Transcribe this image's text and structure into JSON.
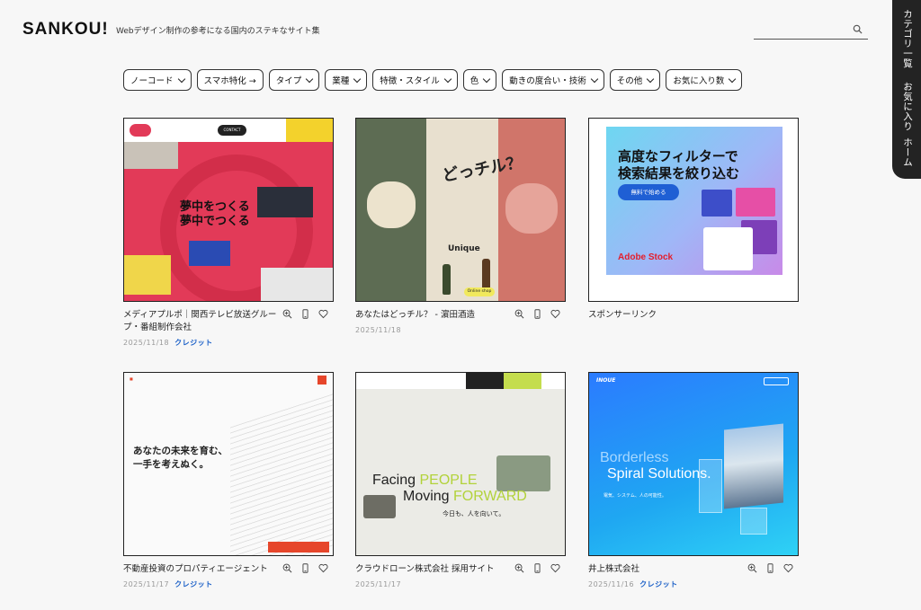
{
  "header": {
    "logo": "SANKOU!",
    "tagline": "Webデザイン制作の参考になる国内のステキなサイト集",
    "search_placeholder": ""
  },
  "side_tab": {
    "items": [
      "カテゴリ一覧",
      "お気に入り",
      "ホーム"
    ]
  },
  "filters": [
    {
      "label": "ノーコード",
      "icon": "chevron-down"
    },
    {
      "label": "スマホ特化 →",
      "icon": "none"
    },
    {
      "label": "タイプ",
      "icon": "chevron-down"
    },
    {
      "label": "業種",
      "icon": "chevron-down"
    },
    {
      "label": "特徴・スタイル",
      "icon": "chevron-down"
    },
    {
      "label": "色",
      "icon": "chevron-down"
    },
    {
      "label": "動きの度合い・技術",
      "icon": "chevron-down"
    },
    {
      "label": "その他",
      "icon": "chevron-down"
    },
    {
      "label": "お気に入り数",
      "icon": "chevron-down"
    }
  ],
  "cards": [
    {
      "title": "メディアプルポ｜関西テレビ放送グループ・番組制作会社",
      "date": "2025/11/18",
      "credit": "クレジット",
      "thumb": {
        "jp_line1": "夢中をつくる",
        "jp_line2": "夢中でつくる",
        "contact": "CONTACT"
      }
    },
    {
      "title": "あなたはどっチル？ - 濵田酒造",
      "date": "2025/11/18",
      "credit": "",
      "thumb": {
        "big": "どっチル？",
        "unique": "Unique",
        "shop": "Online shop"
      }
    },
    {
      "title": "スポンサーリンク",
      "date": "",
      "credit": "",
      "thumb": {
        "headline_1": "高度なフィルターで",
        "headline_2": "検索結果を絞り込む",
        "button": "無料で始める",
        "brand": "Adobe Stock"
      }
    },
    {
      "title": "不動産投資のプロパティエージェント",
      "date": "2025/11/17",
      "credit": "クレジット",
      "thumb": {
        "line1": "あなたの未来を育む、",
        "line2": "一手を考えぬく。"
      }
    },
    {
      "title": "クラウドローン株式会社 採用サイト",
      "date": "2025/11/17",
      "credit": "",
      "thumb": {
        "facing": "Facing ",
        "people": "PEOPLE",
        "moving": "Moving ",
        "forward": "FORWARD",
        "jp": "今日も、人を向いて。"
      }
    },
    {
      "title": "井上株式会社",
      "date": "2025/11/16",
      "credit": "クレジット",
      "thumb": {
        "logo": "INOUE",
        "line1": "Borderless",
        "line2": "Spiral Solutions.",
        "jp": "電気、システム、人の可能性。"
      }
    }
  ],
  "colors": {
    "background": "#f7f7f7",
    "sidebar": "#232323",
    "credit_link": "#1a5fc7"
  }
}
